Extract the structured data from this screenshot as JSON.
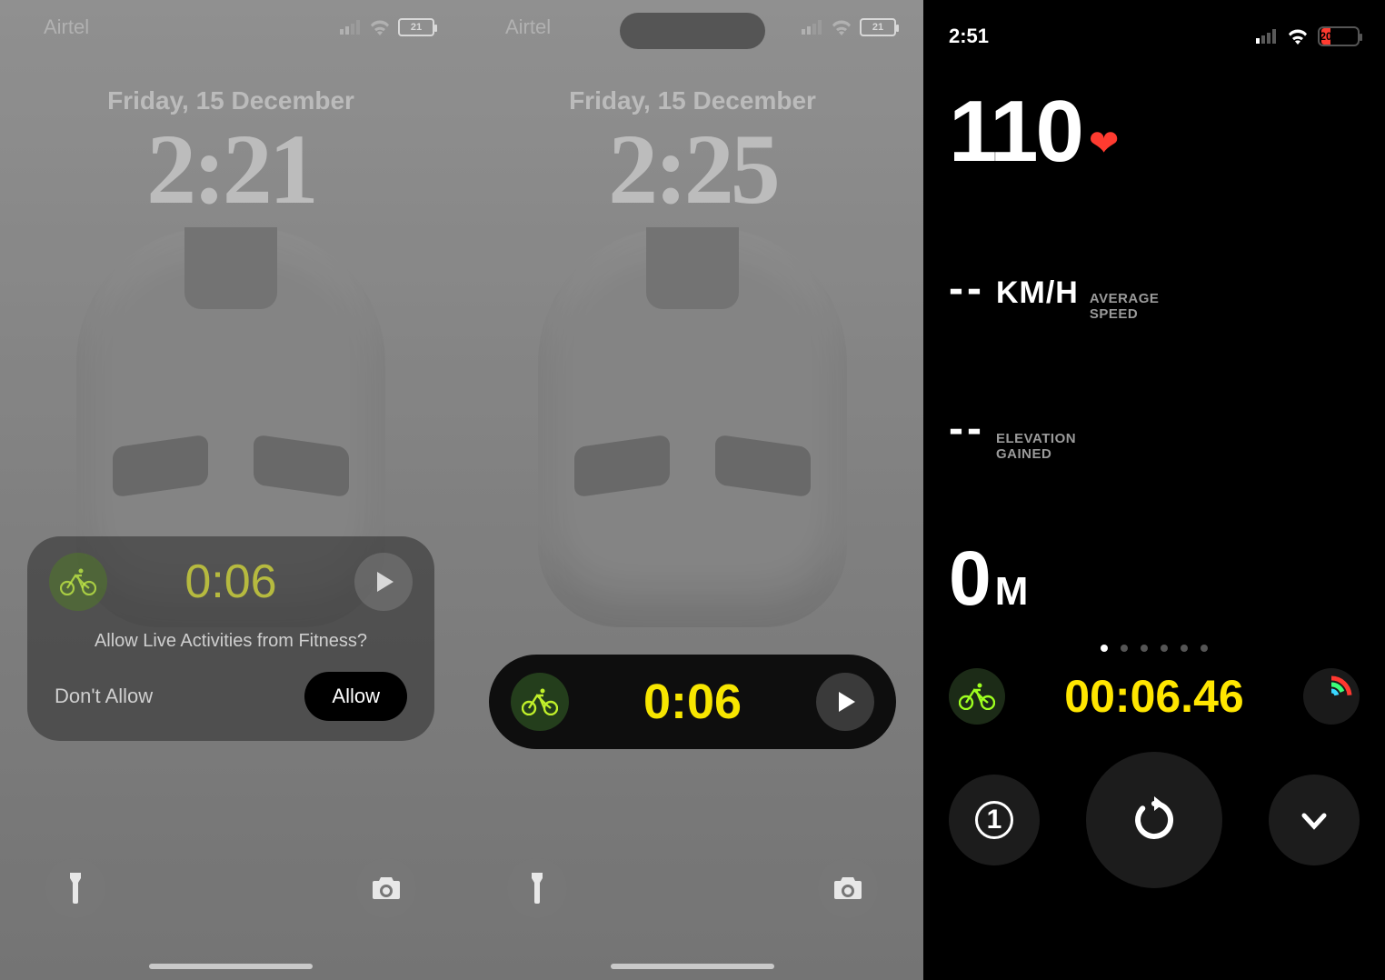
{
  "screen1": {
    "status": {
      "carrier": "Airtel",
      "battery": "21"
    },
    "date": "Friday, 15 December",
    "time": "2:21",
    "live_activity": {
      "timer": "0:06",
      "prompt": "Allow Live Activities from Fitness?",
      "dont_allow": "Don't Allow",
      "allow": "Allow"
    }
  },
  "screen2": {
    "status": {
      "carrier": "Airtel",
      "battery": "21"
    },
    "date": "Friday, 15 December",
    "time": "2:25",
    "live_activity": {
      "timer": "0:06"
    }
  },
  "screen3": {
    "status": {
      "time": "2:51",
      "battery": "20"
    },
    "heart_rate": "110",
    "speed": {
      "value": "--",
      "unit": "KM/H",
      "label1": "AVERAGE",
      "label2": "SPEED"
    },
    "elevation": {
      "value": "--",
      "label1": "ELEVATION",
      "label2": "GAINED"
    },
    "distance": {
      "value": "0",
      "unit": "M"
    },
    "elapsed": "00:06.46",
    "segment": "1"
  }
}
